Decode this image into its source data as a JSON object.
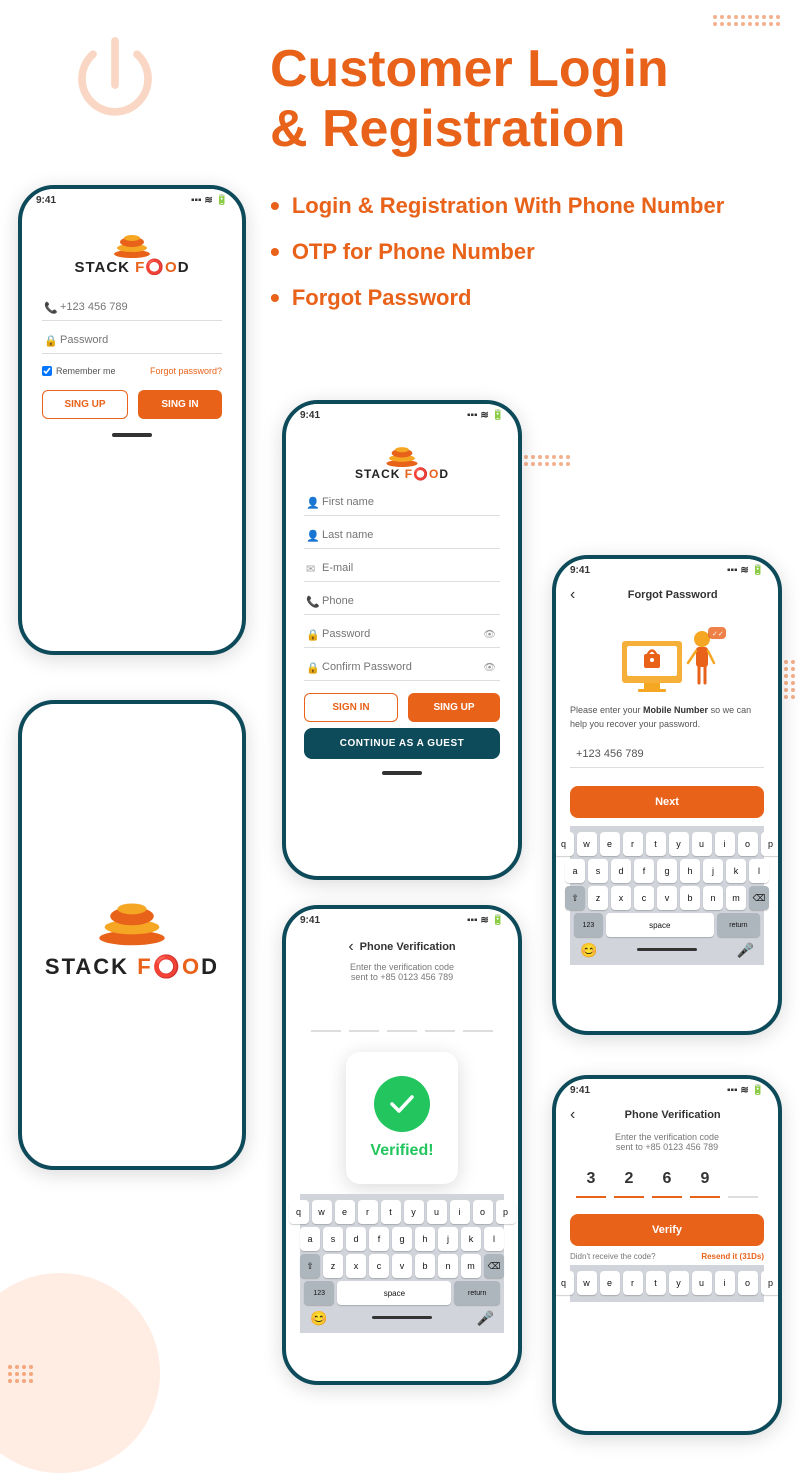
{
  "page": {
    "title": "Customer Login & Registration"
  },
  "header": {
    "title_line1": "Customer Login",
    "title_line2": "& Registration"
  },
  "features": [
    {
      "id": "feat1",
      "text": "Login & Registration With Phone Number"
    },
    {
      "id": "feat2",
      "text": "OTP for Phone Number"
    },
    {
      "id": "feat3",
      "text": "Forgot Password"
    }
  ],
  "phone1": {
    "time": "9:41",
    "logo_text_stack": "STACK",
    "logo_text_food": "F OD",
    "phone_placeholder": "+123 456 789",
    "password_placeholder": "Password",
    "remember_label": "Remember me",
    "forgot_label": "Forgot password?",
    "signup_btn": "SING UP",
    "signin_btn": "SING IN"
  },
  "phone2": {
    "time": "9:41",
    "logo_text_stack": "STACK",
    "logo_text_food": "F OD",
    "firstname_placeholder": "First name",
    "lastname_placeholder": "Last name",
    "email_placeholder": "E-mail",
    "phone_placeholder": "Phone",
    "password_placeholder": "Password",
    "confirm_password_placeholder": "Confirm Password",
    "signin_btn": "SIGN IN",
    "signup_btn": "SING UP",
    "guest_btn": "CONTINUE AS A GUEST"
  },
  "phone3": {
    "logo_text_stack": "STACK",
    "logo_text_food": "F OD"
  },
  "phone4": {
    "time": "9:41",
    "title": "Phone Verification",
    "subtitle": "Enter the verification code",
    "sent_to": "sent to +85 0123 456 789",
    "verified_text": "Verified!",
    "keyboard_rows": [
      [
        "q",
        "w",
        "e",
        "r",
        "t",
        "y",
        "u",
        "i",
        "o",
        "p"
      ],
      [
        "a",
        "s",
        "d",
        "f",
        "g",
        "h",
        "j",
        "k",
        "l"
      ],
      [
        "z",
        "x",
        "c",
        "v",
        "b",
        "n",
        "m"
      ],
      [
        "123",
        "space",
        "return"
      ]
    ]
  },
  "phone5": {
    "time": "9:41",
    "title": "Forgot Password",
    "back_icon": "‹",
    "description_normal": "Please enter your ",
    "description_bold": "Mobile Number",
    "description_end": " so we can help you recover your password.",
    "phone_value": "+123 456 789",
    "next_btn": "Next",
    "keyboard_rows": [
      [
        "q",
        "w",
        "e",
        "r",
        "t",
        "y",
        "u",
        "i",
        "o",
        "p"
      ],
      [
        "a",
        "s",
        "d",
        "f",
        "g",
        "h",
        "j",
        "k",
        "l"
      ],
      [
        "z",
        "x",
        "c",
        "v",
        "b",
        "n",
        "m"
      ],
      [
        "123",
        "space",
        "return"
      ]
    ]
  },
  "phone6": {
    "time": "9:41",
    "title": "Phone Verification",
    "back_icon": "‹",
    "subtitle": "Enter the verification code",
    "sent_to": "sent to +85 0123 456 789",
    "otp_values": [
      "3",
      "2",
      "6",
      "9",
      ""
    ],
    "verify_btn": "Verify",
    "no_code_text": "Didn't receive the code?",
    "resend_text": "Resend it (31Ds)",
    "keyboard_rows": [
      [
        "q",
        "w",
        "e",
        "r",
        "t",
        "y",
        "u",
        "i",
        "o",
        "p"
      ]
    ]
  }
}
